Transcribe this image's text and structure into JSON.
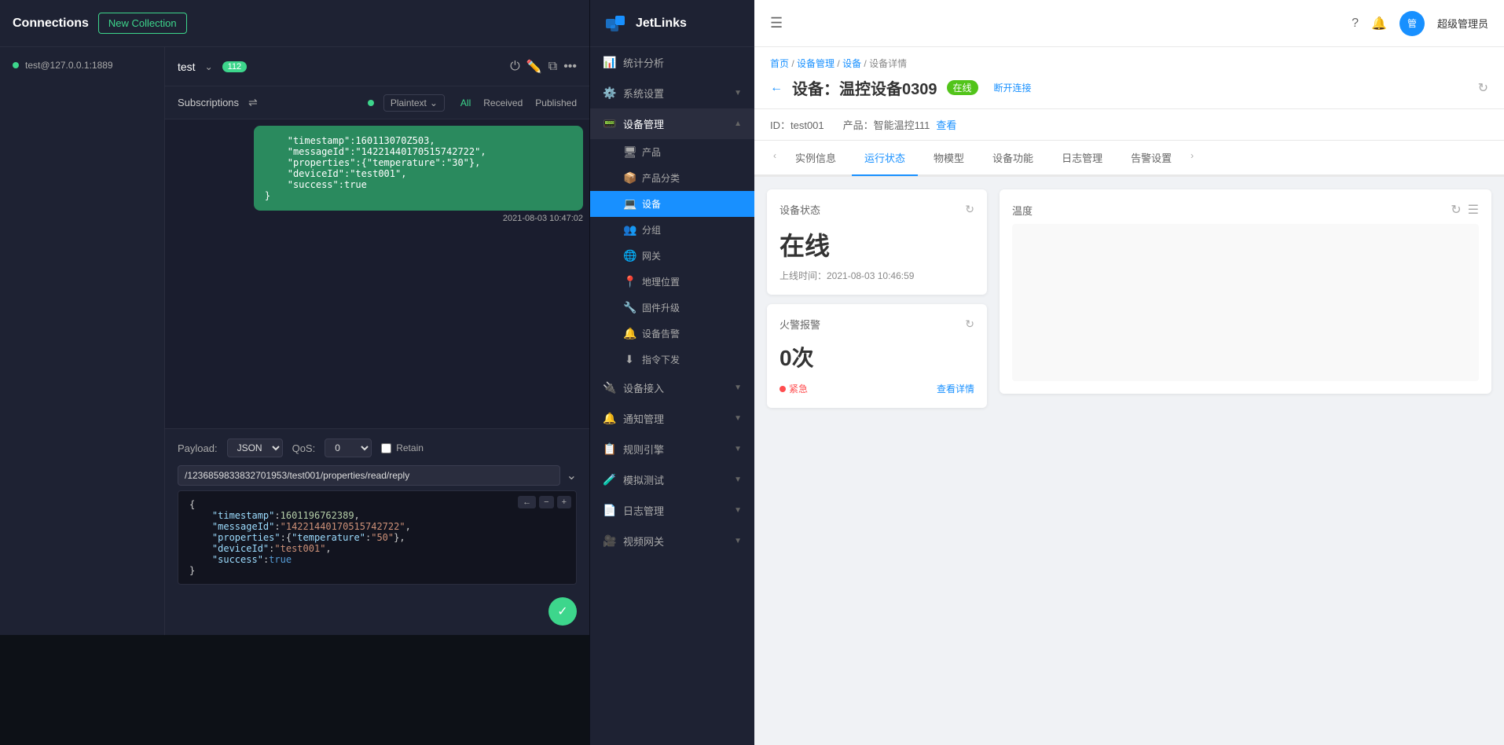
{
  "mqtt": {
    "title": "Connections",
    "new_collection_label": "New Collection",
    "connection": {
      "label": "test@127.0.0.1:1889"
    },
    "tab": {
      "name": "test",
      "badge": "112"
    },
    "subscriptions_label": "Subscriptions",
    "plaintext_label": "Plaintext",
    "filter_tabs": [
      "All",
      "Received",
      "Published"
    ],
    "active_filter": "All",
    "message": {
      "content": "    \"timestamp\":160113070Z503,\n    \"messageId\":\"14221440170515742722\",\n    \"properties\":{\"temperature\":\"30\"},\n    \"deviceId\":\"test001\",\n    \"success\":true\n}",
      "time": "2021-08-03 10:47:02"
    },
    "payload": {
      "label": "Payload:",
      "format": "JSON",
      "qos_label": "QoS:",
      "qos_value": "0",
      "retain_label": "Retain"
    },
    "topic": "/1236859833832701953/test001/properties/read/reply",
    "json_content": "{\n    \"timestamp\":1601196762389,\n    \"messageId\":\"14221440170515742722\",\n    \"properties\":{\"temperature\":\"50\"},\n    \"deviceId\":\"test001\",\n    \"success\":true\n}"
  },
  "jetlinks": {
    "logo_text": "JetLinks",
    "nav": [
      {
        "id": "stats",
        "icon": "📊",
        "label": "统计分析",
        "has_sub": false
      },
      {
        "id": "settings",
        "icon": "⚙️",
        "label": "系统设置",
        "has_sub": true
      },
      {
        "id": "device-mgmt",
        "icon": "📟",
        "label": "设备管理",
        "has_sub": true,
        "active": true
      },
      {
        "id": "product",
        "sub": true,
        "icon": "🖥",
        "label": "产品"
      },
      {
        "id": "product-category",
        "sub": true,
        "icon": "📦",
        "label": "产品分类"
      },
      {
        "id": "device",
        "sub": true,
        "icon": "💻",
        "label": "设备",
        "active": true
      },
      {
        "id": "group",
        "sub": true,
        "icon": "👥",
        "label": "分组"
      },
      {
        "id": "gateway",
        "sub": true,
        "icon": "🌐",
        "label": "网关"
      },
      {
        "id": "geo",
        "sub": true,
        "icon": "📍",
        "label": "地理位置"
      },
      {
        "id": "firmware",
        "sub": true,
        "icon": "🔧",
        "label": "固件升级"
      },
      {
        "id": "device-alert",
        "sub": true,
        "icon": "🔔",
        "label": "设备告警"
      },
      {
        "id": "command",
        "sub": true,
        "icon": "⬇️",
        "label": "指令下发"
      },
      {
        "id": "device-access",
        "icon": "🔌",
        "label": "设备接入",
        "has_sub": true
      },
      {
        "id": "notify",
        "icon": "🔔",
        "label": "通知管理",
        "has_sub": true
      },
      {
        "id": "rules",
        "icon": "📋",
        "label": "规则引擎",
        "has_sub": true
      },
      {
        "id": "simulate",
        "icon": "🧪",
        "label": "模拟测试",
        "has_sub": true
      },
      {
        "id": "log",
        "icon": "📄",
        "label": "日志管理",
        "has_sub": true
      },
      {
        "id": "video",
        "icon": "🎥",
        "label": "视频网关",
        "has_sub": true
      }
    ]
  },
  "device": {
    "header": {
      "admin_label": "超级管理员"
    },
    "breadcrumb": {
      "home": "首页",
      "device_mgmt": "设备管理",
      "device": "设备",
      "detail": "设备详情"
    },
    "title": "设备：温控设备0309",
    "status_label": "在线",
    "disconnect_label": "断开连接",
    "id_label": "ID：test001",
    "product_label": "产品：智能温控111",
    "view_label": "查看",
    "tabs": [
      "实例信息",
      "运行状态",
      "物模型",
      "设备功能",
      "日志管理",
      "告警设置"
    ],
    "active_tab": "运行状态",
    "status_card": {
      "title": "设备状态",
      "value": "在线",
      "online_time": "上线时间：2021-08-03 10:46:59"
    },
    "alert_card": {
      "title": "火警报警",
      "value": "0次",
      "tag": "紧急",
      "view_detail": "查看详情"
    },
    "temp_card": {
      "title": "温度"
    }
  }
}
